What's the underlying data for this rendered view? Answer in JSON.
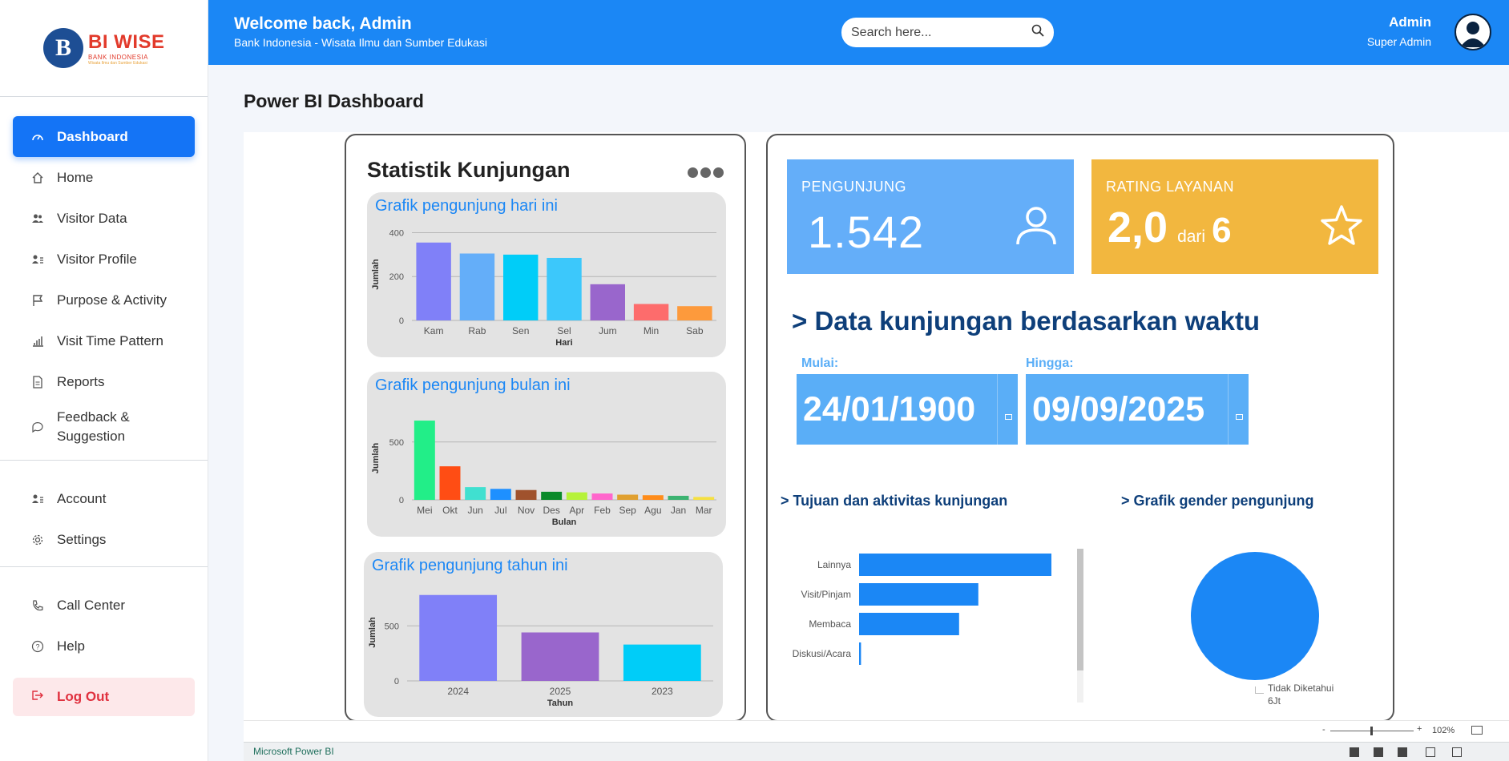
{
  "brand": {
    "name_bi": "BI",
    "name_wise": "WISE",
    "sub": "BANK INDONESIA",
    "tag": "Wisata Ilmu dan Sumber Edukasi"
  },
  "header": {
    "welcome": "Welcome back, Admin",
    "subtitle": "Bank Indonesia - Wisata Ilmu dan Sumber Edukasi",
    "search_placeholder": "Search here...",
    "user_name": "Admin",
    "user_role": "Super Admin"
  },
  "sidebar": {
    "items": [
      {
        "label": "Dashboard",
        "icon": "dashboard-gauge-icon"
      },
      {
        "label": "Home",
        "icon": "home-icon"
      },
      {
        "label": "Visitor Data",
        "icon": "users-icon"
      },
      {
        "label": "Visitor Profile",
        "icon": "user-profile-icon"
      },
      {
        "label": "Purpose & Activity",
        "icon": "flag-icon"
      },
      {
        "label": "Visit Time Pattern",
        "icon": "bar-chart-icon"
      },
      {
        "label": "Reports",
        "icon": "document-icon"
      },
      {
        "label": "Feedback & Suggestion",
        "icon": "chat-bubble-icon"
      }
    ],
    "account_items": [
      {
        "label": "Account",
        "icon": "user-card-icon"
      },
      {
        "label": "Settings",
        "icon": "gear-icon"
      }
    ],
    "support_items": [
      {
        "label": "Call Center",
        "icon": "phone-icon"
      },
      {
        "label": "Help",
        "icon": "help-circle-icon"
      }
    ],
    "logout": "Log Out"
  },
  "main": {
    "title": "Power BI Dashboard"
  },
  "report": {
    "stat_title": "Statistik Kunjungan",
    "kpi_visitors": {
      "label": "PENGUNJUNG",
      "value": "1.542",
      "color": "#64aef9"
    },
    "kpi_rating": {
      "label": "RATING LAYANAN",
      "value": "2,0",
      "of": "dari",
      "max": "6",
      "color": "#f2b73f"
    },
    "time_section": "> Data kunjungan berdasarkan waktu",
    "start_label": "Mulai:",
    "start_date": "24/01/1900",
    "end_label": "Hingga:",
    "end_date": "09/09/2025",
    "purpose_title": "> Tujuan dan aktivitas kunjungan",
    "gender_title": "> Grafik gender pengunjung",
    "gender_legend": "Tidak Diketahui",
    "gender_legend_value": "6Jt"
  },
  "powerbi": {
    "footer": "Microsoft Power BI",
    "zoom": "102%"
  },
  "chart_data": [
    {
      "type": "bar",
      "title": "Grafik pengunjung hari ini",
      "xlabel": "Hari",
      "ylabel": "Jumlah",
      "categories": [
        "Kam",
        "Rab",
        "Sen",
        "Sel",
        "Jum",
        "Min",
        "Sab"
      ],
      "values": [
        355,
        305,
        300,
        285,
        165,
        75,
        65
      ],
      "colors": [
        "#8080f8",
        "#64aef9",
        "#00cdf8",
        "#3cc8fb",
        "#9966cc",
        "#fd6c6c",
        "#fd9a3c"
      ],
      "yticks": [
        0,
        200,
        400
      ],
      "ylim": [
        0,
        420
      ]
    },
    {
      "type": "bar",
      "title": "Grafik pengunjung bulan ini",
      "xlabel": "Bulan",
      "ylabel": "Jumlah",
      "categories": [
        "Mei",
        "Okt",
        "Jun",
        "Jul",
        "Nov",
        "Des",
        "Apr",
        "Feb",
        "Sep",
        "Agu",
        "Jan",
        "Mar"
      ],
      "values": [
        685,
        290,
        110,
        95,
        85,
        70,
        65,
        55,
        45,
        40,
        35,
        25
      ],
      "colors": [
        "#22ee88",
        "#ff4d14",
        "#40e0d0",
        "#1e90ff",
        "#a0522d",
        "#0a8a2a",
        "#b6f23a",
        "#ff66cc",
        "#e0a030",
        "#ff8c1a",
        "#3cb371",
        "#f5e040"
      ],
      "yticks": [
        0,
        500
      ],
      "ylim": [
        0,
        720
      ]
    },
    {
      "type": "bar",
      "title": "Grafik pengunjung tahun ini",
      "xlabel": "Tahun",
      "ylabel": "Jumlah",
      "categories": [
        "2024",
        "2025",
        "2023"
      ],
      "values": [
        780,
        440,
        330
      ],
      "colors": [
        "#8080f8",
        "#9966cc",
        "#00cdf8"
      ],
      "yticks": [
        0,
        500
      ],
      "ylim": [
        0,
        880
      ]
    },
    {
      "type": "bar",
      "title": "Tujuan dan aktivitas kunjungan",
      "orientation": "horizontal",
      "categories": [
        "Lainnya",
        "Visit/Pinjam",
        "Membaca",
        "Diskusi/Acara"
      ],
      "values": [
        100,
        62,
        52,
        1
      ],
      "color": "#1b87f5"
    },
    {
      "type": "pie",
      "title": "Grafik gender pengunjung",
      "labels": [
        "Tidak Diketahui"
      ],
      "values": [
        100
      ],
      "color": "#1b87f5"
    }
  ]
}
